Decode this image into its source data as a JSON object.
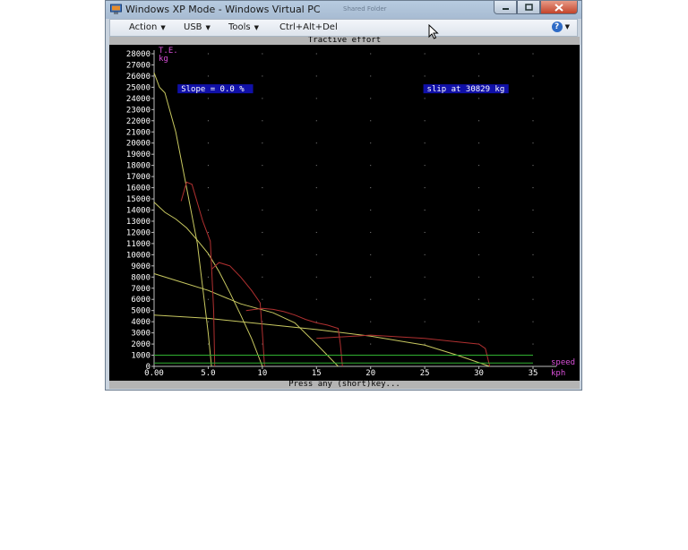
{
  "window": {
    "title": "Windows XP Mode - Windows Virtual PC",
    "ghost_title": "Shared Folder",
    "menu": [
      {
        "label": "Action",
        "has_dropdown": true
      },
      {
        "label": "USB",
        "has_dropdown": true
      },
      {
        "label": "Tools",
        "has_dropdown": true
      },
      {
        "label": "Ctrl+Alt+Del",
        "has_dropdown": false
      }
    ],
    "help_icon": "help-icon"
  },
  "dos": {
    "footer": "Press any (short)key..."
  },
  "colors": {
    "background": "#000000",
    "axis": "#bcbcbc",
    "label": "#d84fd8",
    "badge": "#1010a8",
    "yellow": "#c8c860",
    "red": "#b03030",
    "green": "#30b030"
  },
  "chart_data": {
    "type": "line",
    "title": "Tractive effort",
    "ylabel": "T.E.",
    "yunit": "kg",
    "xlabel": "speed",
    "xunit": "kph",
    "xlim": [
      0,
      35
    ],
    "ylim": [
      0,
      28000
    ],
    "xticks": [
      0,
      5,
      10,
      15,
      20,
      25,
      30,
      35
    ],
    "xtick_labels": [
      "0.00",
      "5.0",
      "10",
      "15",
      "20",
      "25",
      "30",
      "35"
    ],
    "yticks": [
      0,
      1000,
      2000,
      3000,
      4000,
      5000,
      6000,
      7000,
      8000,
      9000,
      10000,
      11000,
      12000,
      13000,
      14000,
      15000,
      16000,
      17000,
      18000,
      19000,
      20000,
      21000,
      22000,
      23000,
      24000,
      25000,
      26000,
      27000,
      28000
    ],
    "grid": "dotted",
    "annotations": [
      {
        "text": "Slope =  0.0 %",
        "x": 2.5,
        "y": 24700
      },
      {
        "text": "slip at 30829 kg",
        "x": 25.2,
        "y": 24700
      }
    ],
    "series": [
      {
        "color": "yellow",
        "x": [
          0,
          0.5,
          1,
          2,
          3,
          4,
          5,
          5.3
        ],
        "y": [
          26300,
          25000,
          24500,
          21000,
          16000,
          11000,
          3000,
          0
        ]
      },
      {
        "color": "yellow",
        "x": [
          0,
          1,
          2,
          3,
          4,
          5,
          6,
          7,
          8,
          9,
          10
        ],
        "y": [
          14700,
          13800,
          13200,
          12400,
          11300,
          10100,
          8500,
          6600,
          4600,
          2500,
          0
        ]
      },
      {
        "color": "yellow",
        "x": [
          0,
          2,
          5,
          8,
          11,
          13,
          15,
          17
        ],
        "y": [
          8300,
          7700,
          6800,
          5600,
          4800,
          3900,
          2000,
          0
        ]
      },
      {
        "color": "yellow",
        "x": [
          0,
          5,
          10,
          15,
          20,
          25,
          28,
          31
        ],
        "y": [
          4600,
          4300,
          3800,
          3300,
          2700,
          1900,
          1000,
          0
        ]
      },
      {
        "color": "red",
        "x": [
          2.5,
          3,
          3.5,
          4.5,
          5.2,
          5.5,
          5.6
        ],
        "y": [
          14800,
          16500,
          16300,
          13000,
          11200,
          5000,
          0
        ]
      },
      {
        "color": "red",
        "x": [
          5.3,
          6,
          7,
          8,
          9,
          9.8,
          10,
          10.2
        ],
        "y": [
          8700,
          9300,
          9000,
          8000,
          6800,
          5700,
          3000,
          0
        ]
      },
      {
        "color": "red",
        "x": [
          8.5,
          10,
          11,
          12,
          13,
          14,
          15,
          16,
          17,
          17.2,
          17.4
        ],
        "y": [
          5000,
          5200,
          5100,
          4900,
          4600,
          4200,
          3900,
          3700,
          3400,
          2000,
          0
        ]
      },
      {
        "color": "red",
        "x": [
          15,
          20,
          25,
          28,
          30,
          30.6,
          31
        ],
        "y": [
          2500,
          2800,
          2500,
          2200,
          2000,
          1600,
          0
        ]
      },
      {
        "color": "green",
        "x": [
          0,
          35
        ],
        "y": [
          1000,
          1000
        ]
      },
      {
        "color": "green",
        "x": [
          0,
          35
        ],
        "y": [
          300,
          300
        ]
      }
    ]
  }
}
